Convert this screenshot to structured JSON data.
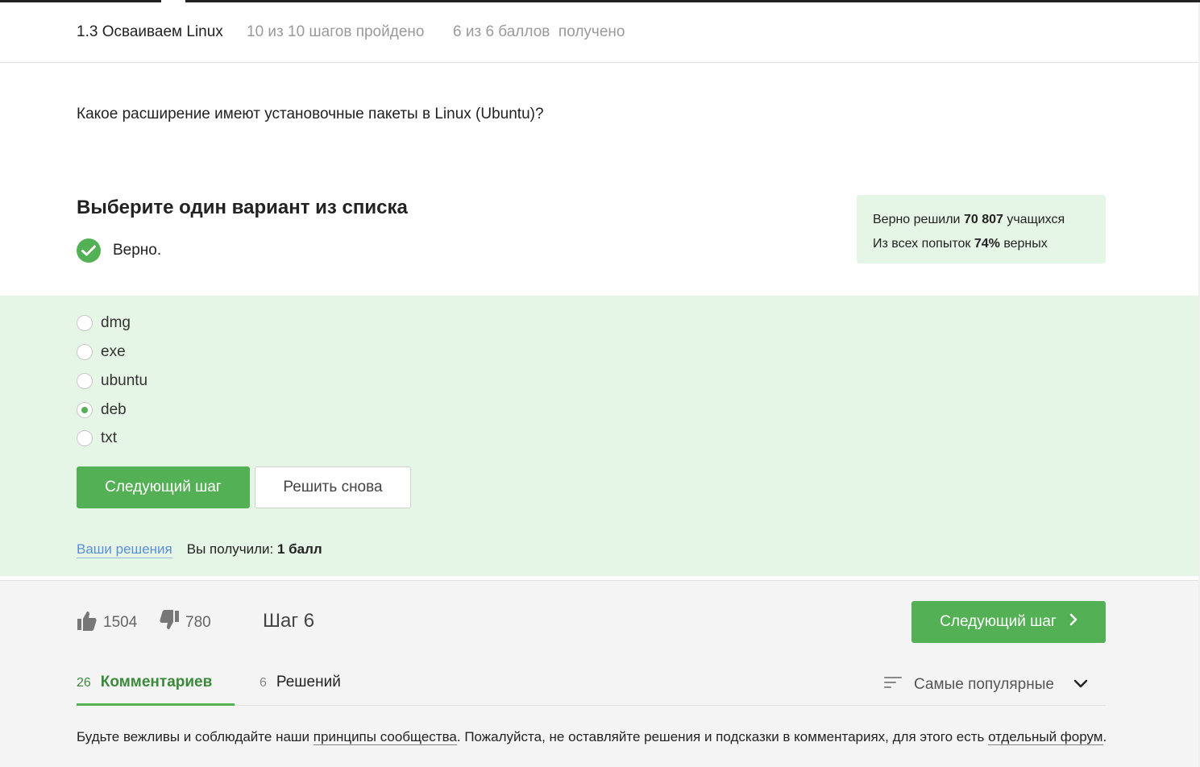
{
  "header": {
    "lesson_title": "1.3 Осваиваем Linux",
    "steps_progress": "10 из 10 шагов пройдено",
    "points_progress": "6 из 6 баллов  получено"
  },
  "question": {
    "text": "Какое расширение имеют установочные пакеты в Linux (Ubuntu)?"
  },
  "quiz": {
    "title": "Выберите один вариант из списка",
    "verdict": "Верно.",
    "options": [
      {
        "label": "dmg",
        "selected": false
      },
      {
        "label": "exe",
        "selected": false
      },
      {
        "label": "ubuntu",
        "selected": false
      },
      {
        "label": "deb",
        "selected": true
      },
      {
        "label": "txt",
        "selected": false
      }
    ],
    "next_label": "Следующий шаг",
    "retry_label": "Решить снова",
    "your_solutions_link": "Ваши решения",
    "got_prefix": "Вы получили:",
    "got_value": "1 балл"
  },
  "stats": {
    "solved_prefix": "Верно решили",
    "solved_count": "70 807",
    "solved_suffix": "учащихся",
    "attempts_prefix": "Из всех попыток",
    "attempts_percent": "74%",
    "attempts_suffix": "верных"
  },
  "footer": {
    "likes": "1504",
    "dislikes": "780",
    "step_label": "Шаг 6",
    "next_label": "Следующий шаг"
  },
  "discussion": {
    "comments_count": "26",
    "comments_label": "Комментариев",
    "solutions_count": "6",
    "solutions_label": "Решений",
    "sort_label": "Самые популярные",
    "rules_text_1": "Будьте вежливы и соблюдайте наши ",
    "rules_link_1": "принципы сообщества",
    "rules_text_2": ". Пожалуйста, не оставляйте решения и подсказки в комментариях, для этого есть ",
    "rules_link_2": "отдельный форум",
    "rules_text_3": "."
  },
  "colors": {
    "accent_green": "#54b054",
    "light_green_bg": "#e6f6e6",
    "link_blue": "#5b8ed8"
  }
}
